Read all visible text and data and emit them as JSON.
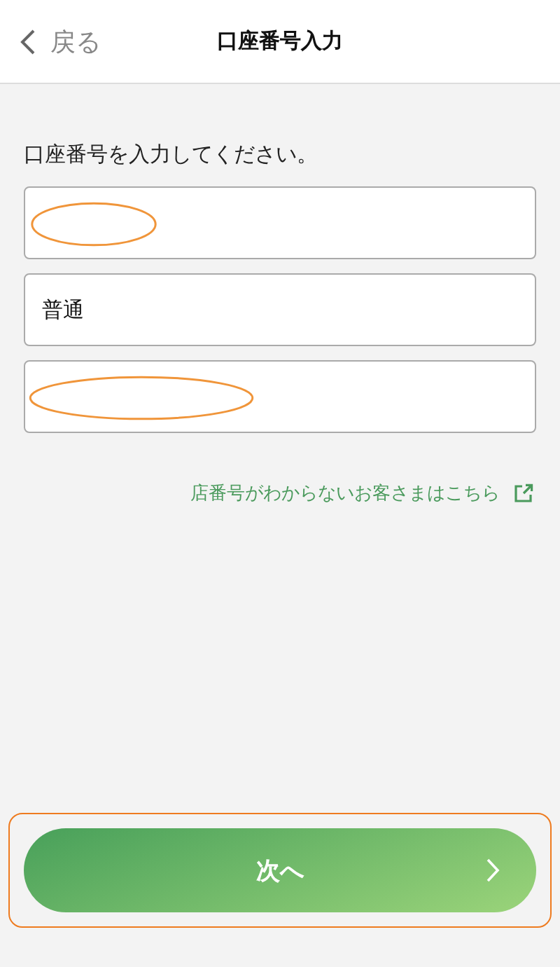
{
  "header": {
    "back": "戻る",
    "title": "口座番号入力"
  },
  "instruction": "口座番号を入力してください。",
  "fields": [
    {
      "marked": true
    },
    {
      "value": "普通",
      "marked": false
    },
    {
      "marked": true
    }
  ],
  "link": "店番号がわからないお客さまはこちら",
  "next_button": {
    "label": "次へ",
    "highlighted": true
  }
}
